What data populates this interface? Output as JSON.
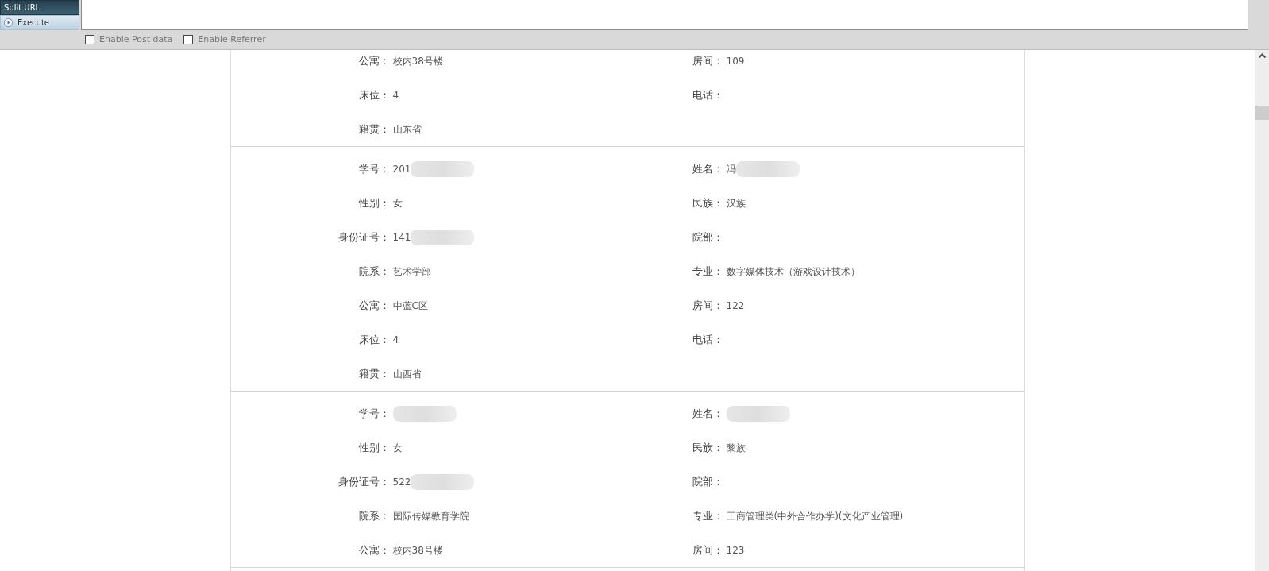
{
  "hackbar": {
    "buttons": [
      {
        "label": "Split URL"
      },
      {
        "label": "Execute"
      }
    ],
    "checkboxes": [
      {
        "label": "Enable Post data",
        "checked": false
      },
      {
        "label": "Enable Referrer",
        "checked": false
      }
    ]
  },
  "records": [
    {
      "fields": [
        {
          "label": "公寓：",
          "value": "校内38号楼"
        },
        {
          "label": "房间：",
          "value": "109"
        },
        {
          "label": "床位：",
          "value": "4"
        },
        {
          "label": "电话："
        },
        {
          "label": "籍贯：",
          "value": "山东省"
        }
      ]
    },
    {
      "fields": [
        {
          "label": "学号：",
          "value": "201",
          "redacted": true
        },
        {
          "label": "姓名：",
          "value": "冯",
          "redacted": true
        },
        {
          "label": "性别：",
          "value": "女"
        },
        {
          "label": "民族：",
          "value": "汉族"
        },
        {
          "label": "身份证号：",
          "value": "141",
          "redacted": true
        },
        {
          "label": "院部："
        },
        {
          "label": "院系：",
          "value": "艺术学部"
        },
        {
          "label": "专业：",
          "value": "数字媒体技术（游戏设计技术）"
        },
        {
          "label": "公寓：",
          "value": "中蓝C区"
        },
        {
          "label": "房间：",
          "value": "122"
        },
        {
          "label": "床位：",
          "value": "4"
        },
        {
          "label": "电话："
        },
        {
          "label": "籍贯：",
          "value": "山西省"
        }
      ]
    },
    {
      "fields": [
        {
          "label": "学号：",
          "redacted": true
        },
        {
          "label": "姓名：",
          "redacted": true
        },
        {
          "label": "性别：",
          "value": "女"
        },
        {
          "label": "民族：",
          "value": "黎族"
        },
        {
          "label": "身份证号：",
          "value": "522",
          "redacted": true
        },
        {
          "label": "院部："
        },
        {
          "label": "院系：",
          "value": "国际传媒教育学院"
        },
        {
          "label": "专业：",
          "value": "工商管理类(中外合作办学)(文化产业管理)"
        },
        {
          "label": "公寓：",
          "value": "校内38号楼"
        },
        {
          "label": "房间：",
          "value": "123"
        }
      ]
    }
  ]
}
